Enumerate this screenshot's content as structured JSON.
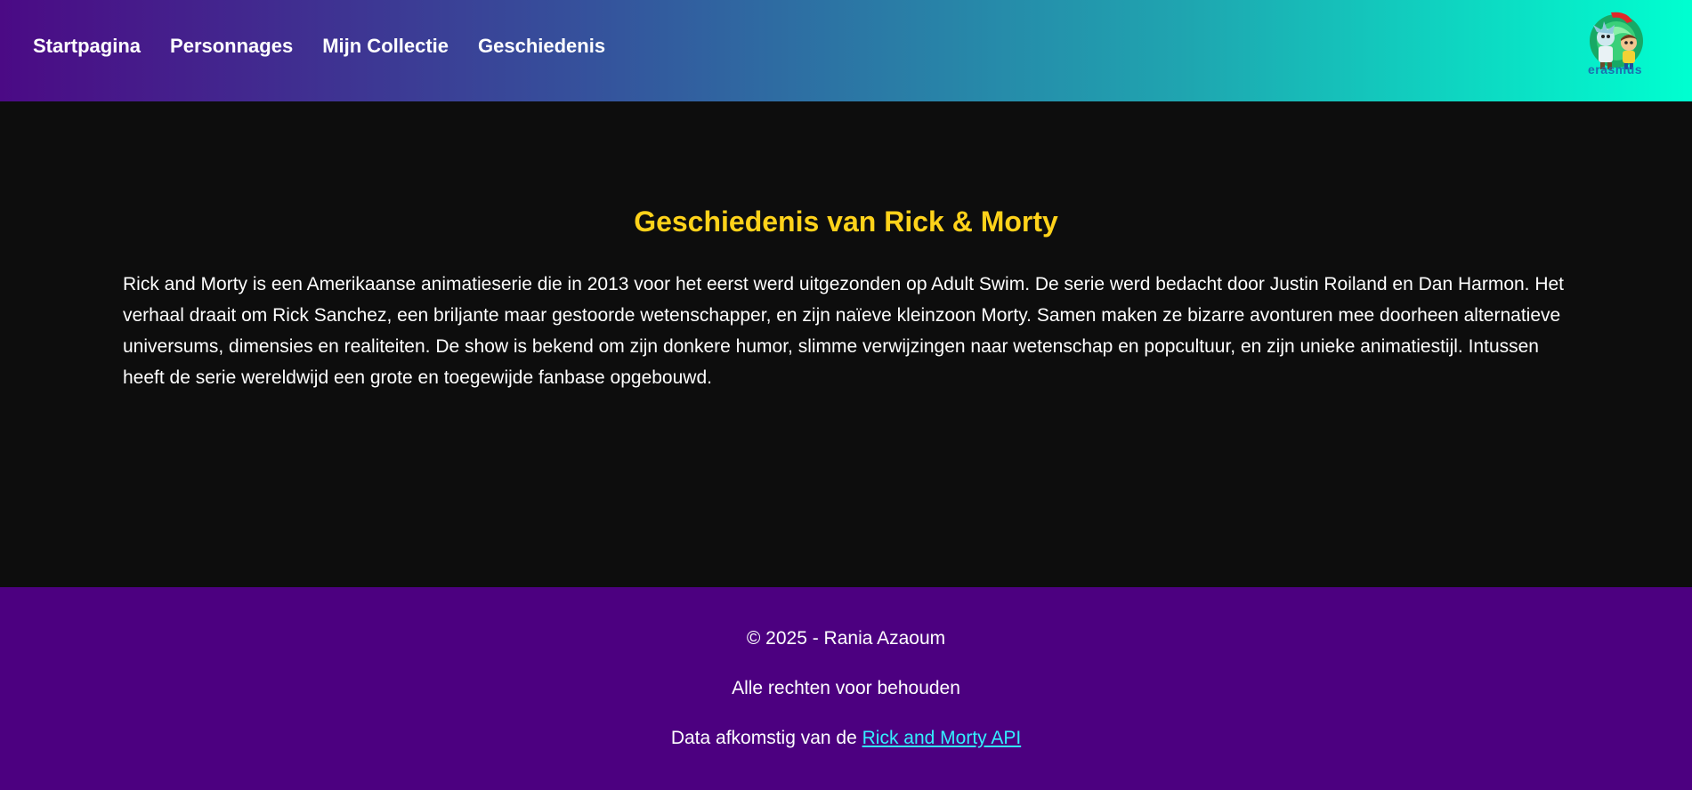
{
  "nav": {
    "items": [
      {
        "label": "Startpagina"
      },
      {
        "label": "Personnages"
      },
      {
        "label": "Mijn Collectie"
      },
      {
        "label": "Geschiedenis"
      }
    ],
    "logo_text": "erasmus",
    "gradient": [
      "#4b0a85",
      "#35529c",
      "#1fa5b0",
      "#00ffd0"
    ]
  },
  "main": {
    "title": "Geschiedenis van Rick & Morty",
    "paragraph": "Rick and Morty is een Amerikaanse animatieserie die in 2013 voor het eerst werd uitgezonden op Adult Swim. De serie werd bedacht door Justin Roiland en Dan Harmon. Het verhaal draait om Rick Sanchez, een briljante maar gestoorde wetenschapper, en zijn naïeve kleinzoon Morty. Samen maken ze bizarre avonturen mee doorheen alternatieve universums, dimensies en realiteiten. De show is bekend om zijn donkere humor, slimme verwijzingen naar wetenschap en popcultuur, en zijn unieke animatiestijl. Intussen heeft de serie wereldwijd een grote en toegewijde fanbase opgebouwd.",
    "title_color": "#ffd21a",
    "background": "#0d0d0d"
  },
  "footer": {
    "copyright": "© 2025 - Rania Azaoum",
    "rights": "Alle rechten voor behouden",
    "source_prefix": "Data afkomstig van de ",
    "source_link": "Rick and Morty API",
    "background": "#4c0080",
    "link_color": "#33f0ff"
  }
}
